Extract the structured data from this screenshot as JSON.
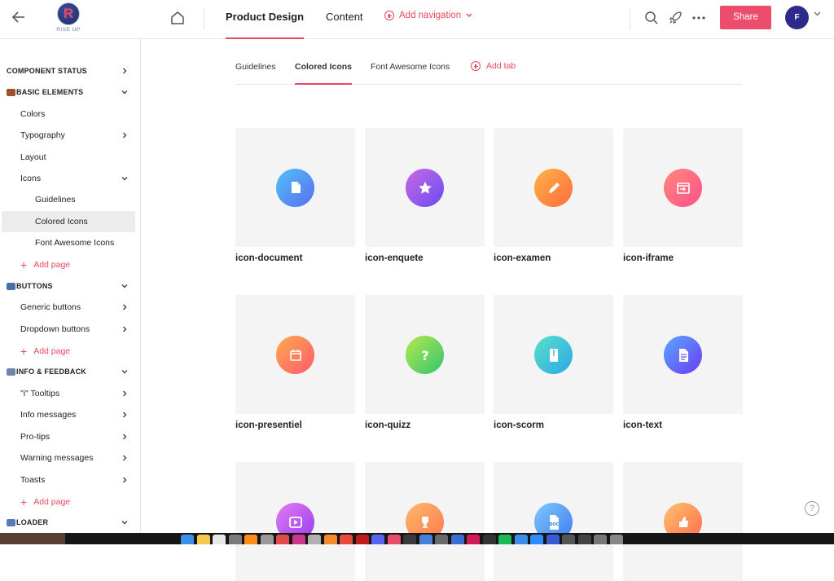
{
  "topbar": {
    "logo_letter": "R",
    "logo_text": "RISE UP",
    "tabs": [
      {
        "label": "Product Design",
        "active": true
      },
      {
        "label": "Content",
        "active": false
      }
    ],
    "add_navigation": "Add navigation",
    "share_label": "Share",
    "avatar_initial": "F"
  },
  "sidebar": {
    "items": [
      {
        "label": "COMPONENT STATUS",
        "type": "section",
        "chevron": "right"
      },
      {
        "label": "BASIC ELEMENTS",
        "type": "section",
        "chevron": "down",
        "emoji": "hat"
      },
      {
        "label": "Colors",
        "type": "item",
        "chevron": ""
      },
      {
        "label": "Typography",
        "type": "item",
        "chevron": "right"
      },
      {
        "label": "Layout",
        "type": "item",
        "chevron": ""
      },
      {
        "label": "Icons",
        "type": "item",
        "chevron": "down"
      },
      {
        "label": "Guidelines",
        "type": "subitem",
        "chevron": ""
      },
      {
        "label": "Colored Icons",
        "type": "subitem",
        "chevron": "",
        "selected": true
      },
      {
        "label": "Font Awesome Icons",
        "type": "subitem",
        "chevron": ""
      },
      {
        "label": "Add page",
        "type": "add"
      },
      {
        "label": "BUTTONS",
        "type": "section",
        "chevron": "down",
        "emoji": "ok"
      },
      {
        "label": "Generic buttons",
        "type": "item",
        "chevron": "right"
      },
      {
        "label": "Dropdown buttons",
        "type": "item",
        "chevron": "right"
      },
      {
        "label": "Add page",
        "type": "add"
      },
      {
        "label": "INFO & FEEDBACK",
        "type": "section",
        "chevron": "down",
        "emoji": "book"
      },
      {
        "label": "\"i\" Tooltips",
        "type": "item",
        "chevron": "right"
      },
      {
        "label": "Info messages",
        "type": "item",
        "chevron": "right"
      },
      {
        "label": "Pro-tips",
        "type": "item",
        "chevron": "right"
      },
      {
        "label": "Warning messages",
        "type": "item",
        "chevron": "right"
      },
      {
        "label": "Toasts",
        "type": "item",
        "chevron": "right"
      },
      {
        "label": "Add page",
        "type": "add"
      },
      {
        "label": "LOADER",
        "type": "section",
        "chevron": "down",
        "emoji": "cd"
      }
    ]
  },
  "content_tabs": [
    {
      "label": "Guidelines",
      "active": false
    },
    {
      "label": "Colored Icons",
      "active": true
    },
    {
      "label": "Font Awesome Icons",
      "active": false
    }
  ],
  "add_tab": "Add tab",
  "icons": [
    {
      "name": "icon-document",
      "glyph": "document",
      "colors": [
        "#4fc3f7",
        "#5b6cf0"
      ]
    },
    {
      "name": "icon-enquete",
      "glyph": "star",
      "colors": [
        "#c86ae6",
        "#6a4cf0"
      ]
    },
    {
      "name": "icon-examen",
      "glyph": "pencil",
      "colors": [
        "#ffb347",
        "#ff6b3d"
      ]
    },
    {
      "name": "icon-iframe",
      "glyph": "window",
      "colors": [
        "#ff8a7a",
        "#ff4f8b"
      ]
    },
    {
      "name": "icon-presentiel",
      "glyph": "calendar",
      "colors": [
        "#ffa94d",
        "#ff5b6e"
      ]
    },
    {
      "name": "icon-quizz",
      "glyph": "question",
      "colors": [
        "#b6e84c",
        "#34c56e"
      ]
    },
    {
      "name": "icon-scorm",
      "glyph": "zip",
      "colors": [
        "#5be0c8",
        "#2aa8e8"
      ]
    },
    {
      "name": "icon-text",
      "glyph": "text",
      "colors": [
        "#5aa8ff",
        "#6a3cf0"
      ]
    },
    {
      "name": "",
      "glyph": "video",
      "colors": [
        "#e07cf0",
        "#9b3cf0"
      ]
    },
    {
      "name": "",
      "glyph": "trophy",
      "colors": [
        "#ffb86b",
        "#ff7a4d"
      ]
    },
    {
      "name": "",
      "glyph": "doc",
      "colors": [
        "#7fc8ff",
        "#3d7cf0"
      ]
    },
    {
      "name": "",
      "glyph": "thumb",
      "colors": [
        "#ffc36b",
        "#ff6b4d"
      ]
    }
  ],
  "help_label": "?",
  "colors": {
    "accent": "#e8495f",
    "share": "#ec4d6c",
    "avatar": "#2d2a8c"
  }
}
